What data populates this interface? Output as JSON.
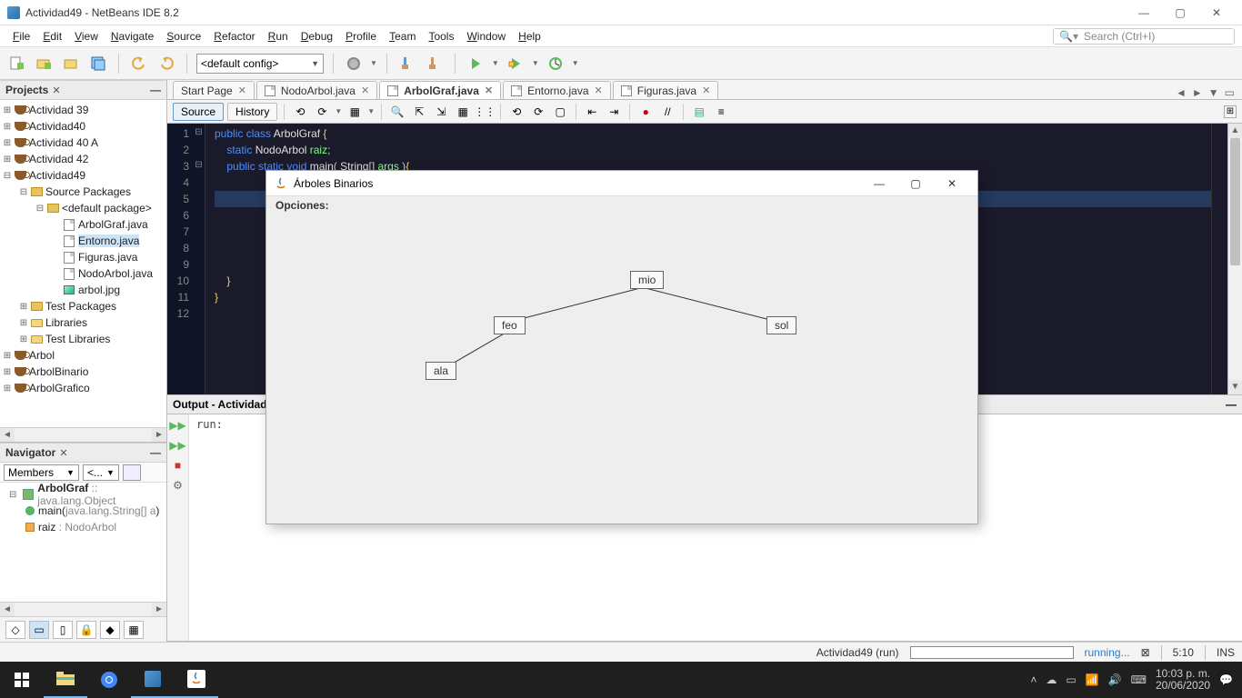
{
  "window_title": "Actividad49 - NetBeans IDE 8.2",
  "window_controls": {
    "min": "—",
    "max": "▢",
    "close": "✕"
  },
  "menu": {
    "items": [
      "File",
      "Edit",
      "View",
      "Navigate",
      "Source",
      "Refactor",
      "Run",
      "Debug",
      "Profile",
      "Team",
      "Tools",
      "Window",
      "Help"
    ],
    "search_placeholder": "Search (Ctrl+I)"
  },
  "toolbar": {
    "config": "<default config>"
  },
  "projects_panel": {
    "title": "Projects",
    "tree": {
      "a39": "Actividad 39",
      "a40": "Actividad40",
      "a40a": "Actividad 40 A",
      "a42": "Actividad 42",
      "a49": "Actividad49",
      "src": "Source Packages",
      "defpkg": "<default package>",
      "f_arbolgraf": "ArbolGraf.java",
      "f_entorno": "Entorno.java",
      "f_figuras": "Figuras.java",
      "f_nodo": "NodoArbol.java",
      "f_img": "arbol.jpg",
      "test": "Test Packages",
      "libs": "Libraries",
      "testlibs": "Test Libraries",
      "arbol": "Arbol",
      "arbolbin": "ArbolBinario",
      "arbolgraf": "ArbolGrafico"
    }
  },
  "navigator": {
    "title": "Navigator",
    "combo": "Members",
    "filter": "<...",
    "class": "ArbolGraf",
    "class_ext": " :: java.lang.Object",
    "m_main": "main(",
    "m_main_arg": "java.lang.String[] a",
    "m_main_close": ")",
    "m_raiz": "raiz",
    "m_raiz_t": " : NodoArbol"
  },
  "tabs": {
    "items": [
      "Start Page",
      "NodoArbol.java",
      "ArbolGraf.java",
      "Entorno.java",
      "Figuras.java"
    ],
    "active": 2
  },
  "editor_sub": {
    "source": "Source",
    "history": "History"
  },
  "code": {
    "lines": [
      {
        "n": 1,
        "html": "<span class='kw'>public</span> <span class='kw'>class</span> <span class='cls'>ArbolGraf</span> <span class='br'>{</span>"
      },
      {
        "n": 2,
        "html": "    <span class='kw'>static</span> <span class='cls'>NodoArbol</span> <span class='id'>raiz</span>;"
      },
      {
        "n": 3,
        "html": "    <span class='kw'>public</span> <span class='kw'>static</span> <span class='kw'>void</span> <span class='cls'>main</span>( <span class='cls'>String</span>[] <span class='id'>args</span> )<span class='br'>{</span>"
      },
      {
        "n": 4,
        "html": ""
      },
      {
        "n": 5,
        "html": ""
      },
      {
        "n": 6,
        "html": ""
      },
      {
        "n": 7,
        "html": ""
      },
      {
        "n": 8,
        "html": ""
      },
      {
        "n": 9,
        "html": ""
      },
      {
        "n": 10,
        "html": "    <span class='br'>}</span>"
      },
      {
        "n": 11,
        "html": "<span class='br'>}</span>"
      },
      {
        "n": 12,
        "html": ""
      }
    ],
    "hl_row": 5
  },
  "output": {
    "title": "Output - Actividad",
    "text": "run:"
  },
  "status": {
    "task": "Actividad49 (run)",
    "running": "running...",
    "pos": "5:10",
    "ins": "INS"
  },
  "java_window": {
    "title": "Árboles Binarios",
    "menu": "Opciones:",
    "nodes": {
      "mio": "mio",
      "feo": "feo",
      "sol": "sol",
      "ala": "ala"
    }
  },
  "taskbar": {
    "time": "10:03 p. m.",
    "date": "20/06/2020"
  }
}
